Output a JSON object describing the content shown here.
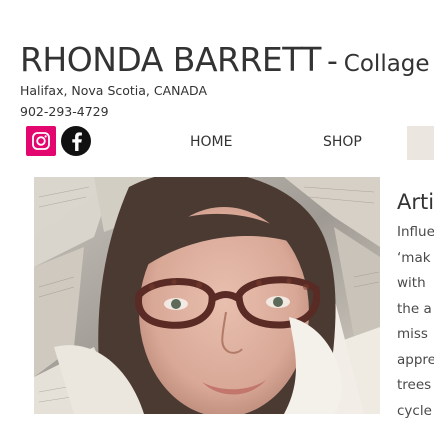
{
  "header": {
    "name": "RHONDA BARRETT",
    "dash": "-",
    "subtitle": "Collage",
    "location": "Halifax, Nova Scotia, CANADA",
    "phone": "902-293-4729"
  },
  "social": [
    {
      "icon": "instagram-icon",
      "color": "#e4066f"
    },
    {
      "icon": "facebook-icon",
      "color": "#111111"
    }
  ],
  "nav": {
    "items": [
      "HOME",
      "SHOP"
    ]
  },
  "main": {
    "heading": "Artis",
    "bio_lines": [
      "Influe",
      "‘mak",
      "with",
      "the a",
      "miss",
      "appre",
      "trees",
      "cycle"
    ]
  }
}
